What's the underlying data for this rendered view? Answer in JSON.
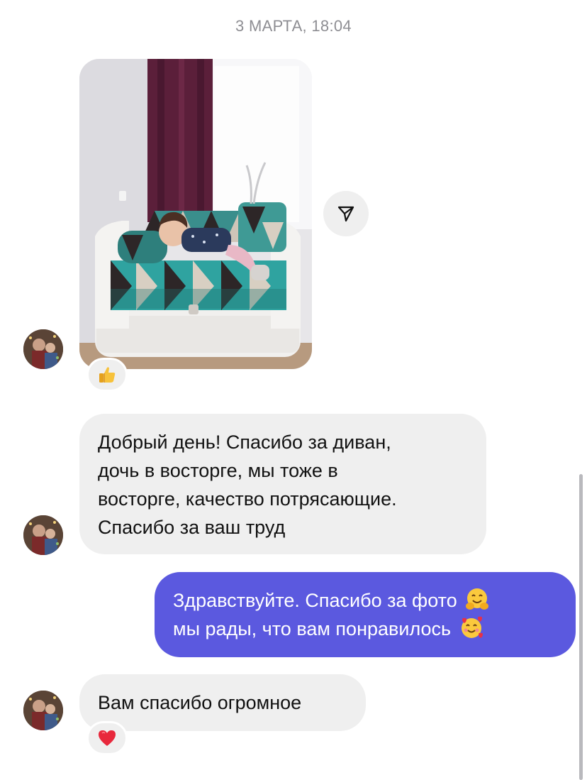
{
  "conversation": {
    "timestamp": "3 МАРТА, 18:04",
    "messages": [
      {
        "type": "image",
        "sender": "incoming",
        "reaction": "thumbs-up",
        "share_icon": "send-icon"
      },
      {
        "type": "text",
        "sender": "incoming",
        "lines": [
          "Добрый день! Спасибо за диван,",
          "дочь в восторге, мы тоже в",
          "восторге, качество потрясающие.",
          "Спасибо за ваш труд"
        ]
      },
      {
        "type": "text",
        "sender": "outgoing",
        "lines": [
          "Здравствуйте. Спасибо за фото",
          "мы рады, что вам понравилось"
        ],
        "emojis": [
          "hugging-face-icon",
          "smiling-face-with-hearts-icon"
        ]
      },
      {
        "type": "text",
        "sender": "incoming",
        "lines": [
          "Вам спасибо огромное"
        ],
        "reaction": "red-heart"
      }
    ]
  },
  "colors": {
    "incoming_bubble": "#efefef",
    "outgoing_bubble": "#5b59df",
    "timestamp": "#8e8e93"
  }
}
